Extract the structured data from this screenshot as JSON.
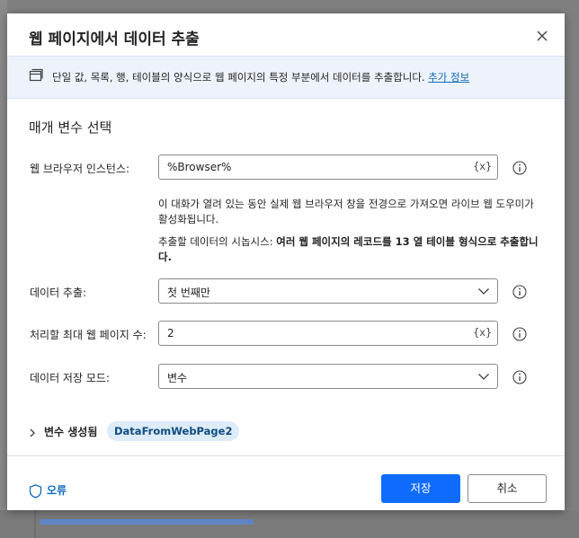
{
  "dialog": {
    "title": "웹 페이지에서 데이터 추출",
    "banner": {
      "text": "단일 값, 목록, 행, 테이블의 양식으로 웹 페이지의 특정 부분에서 데이터를 추출합니다.",
      "link": "추가 정보"
    },
    "section_title": "매개 변수 선택",
    "fields": {
      "browser_instance": {
        "label": "웹 브라우저 인스턴스:",
        "value": "%Browser%",
        "var_button": "{x}"
      },
      "extract_data": {
        "label": "데이터 추출:",
        "value": "첫 번째만"
      },
      "max_pages": {
        "label": "처리할 최대 웹 페이지 수:",
        "value": "2",
        "var_button": "{x}"
      },
      "storage_mode": {
        "label": "데이터 저장 모드:",
        "value": "변수"
      }
    },
    "description": {
      "line1": "이 대화가 열려 있는 동안 실제 웹 브라우저 창을 전경으로 가져오면 라이브 웹 도우미가 활성화됩니다.",
      "line2_prefix": "추출할 데이터의 시놉시스: ",
      "line2_bold": "여러 웹 페이지의 레코드를 13 열 테이블 형식으로 추출합니다."
    },
    "variables_produced": {
      "label": "변수 생성됨",
      "badge": "DataFromWebPage2"
    },
    "footer": {
      "errors_label": "오류",
      "save_label": "저장",
      "cancel_label": "취소"
    }
  },
  "colors": {
    "primary": "#0f6cff",
    "link": "#0f6cbd",
    "banner_bg": "#eef3fb",
    "badge_bg": "#deecf9"
  },
  "icons": [
    "close-icon",
    "window-icon",
    "info-icon",
    "chevron-down-icon",
    "chevron-right-icon",
    "shield-icon"
  ]
}
